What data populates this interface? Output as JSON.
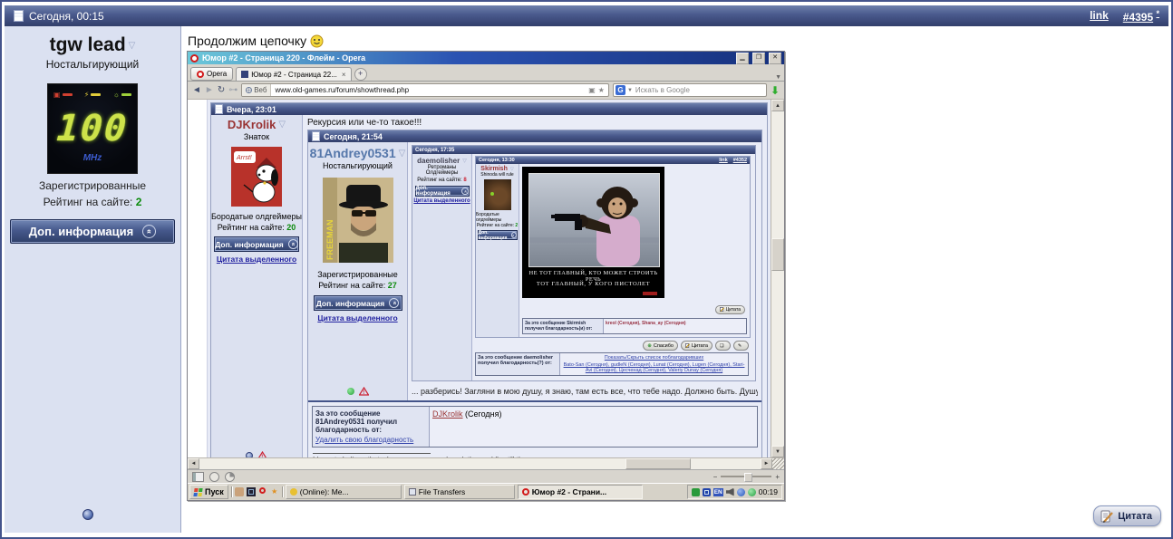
{
  "shared": {
    "rating_label": "Рейтинг на сайте:",
    "info_button": "Доп. информация",
    "quote_selected": "Цитата выделенного",
    "quote": "Цитата",
    "thanks_btn": "Спасибо",
    "link": "link",
    "star": "*"
  },
  "outer": {
    "date": "Сегодня, 00:15",
    "post_number": "#4395",
    "message": "Продолжим цепочку",
    "user": {
      "name": "tgw lead",
      "title": "Ностальгирующий",
      "group": "Зарегистрированные",
      "rating": "2",
      "avatar_value": "100",
      "avatar_unit": "MHz"
    }
  },
  "opera": {
    "window_title": "Юмор #2 - Страница 220 - Флейм - Opera",
    "menu_button": "Opera",
    "tab_title": "Юмор #2 - Страница 22...",
    "tab_close": "×",
    "url_badge": "Веб",
    "url": "www.old-games.ru/forum/showthread.php",
    "search_badge": "G",
    "search_placeholder": "Искать в Google"
  },
  "taskbar": {
    "start": "Пуск",
    "task_online": "(Online): Me...",
    "task_transfers": "File Transfers",
    "task_opera": "Юмор #2 - Страни...",
    "lang": "EN",
    "clock": "00:19"
  },
  "thread": {
    "post1": {
      "date": "Вчера, 23:01",
      "name": "DJKrolik",
      "title": "Знаток",
      "group": "Бородатые олдгеймеры",
      "rating": "20",
      "subject": "Рекурсия или че-то такое!!!",
      "avatar_text": "Arrst!"
    },
    "post2": {
      "date": "Сегодня, 21:54",
      "name": "81Andrey0531",
      "title": "Ностальгирующий",
      "group": "Зарегистрированные",
      "rating": "27",
      "avatar_text": "FREEMAN",
      "text": "... разберись! Загляни в мою душу, я знаю, там есть все, что тебе надо. Должно быть. Душу-то ведь я никогда и никону не пр",
      "thanks_label": "За это сообщение 81Andrey0531 получил благодарность от:",
      "thanks_remove": "Удалить свою благодарность",
      "thanks_name": "DJKrolik",
      "thanks_when": "(Сегодня)",
      "signature": "I have to believe that when my eyes are closed, the world's still there"
    },
    "post3": {
      "date": "Сегодня, 17:35",
      "name": "daemolisher",
      "title_line1": "Ретроманы",
      "title_line2": "Олдгеймеры",
      "rating": "8",
      "thanks_label": "За это сообщение daemolisher получил благодарность(?) от:",
      "thanks_toggle": "Показать/Скрыть список поблагодаривших",
      "thanks_names": "Bato-San (Сегодня), gudleN (Сегодня), Lunat (Сегодня), Lugen (Сегодня), Stari-Avi (Сегодня), Цесченад (Сегодня), Valeriy Dunay (Сегодня)"
    },
    "post4": {
      "date": "Сегодня, 13:30",
      "post_number": "#4352",
      "name": "Skirmish",
      "title": "Shinoda will rule",
      "group": "Бородатые олдгеймеры",
      "rating": "2",
      "demot_line1": "НЕ ТОТ ГЛАВНЫЙ, КТО МОЖЕТ СТРОИТЬ РЕЧЬ",
      "demot_line2": "ТОТ ГЛАВНЫЙ, У КОГО ПИСТОЛЕТ",
      "thanks_label": "За это сообщение Skirmish получил благодарность(и) от:",
      "thanks_names": "kreol (Сегодня), Shana_ay (Сегодня)"
    }
  },
  "colors": {
    "rating_positive": "#0a8a0a",
    "username_red": "#993333",
    "username_blue": "#5577aa",
    "header_blue": "#49598c",
    "opera_brand_red": "#d21c1c"
  }
}
